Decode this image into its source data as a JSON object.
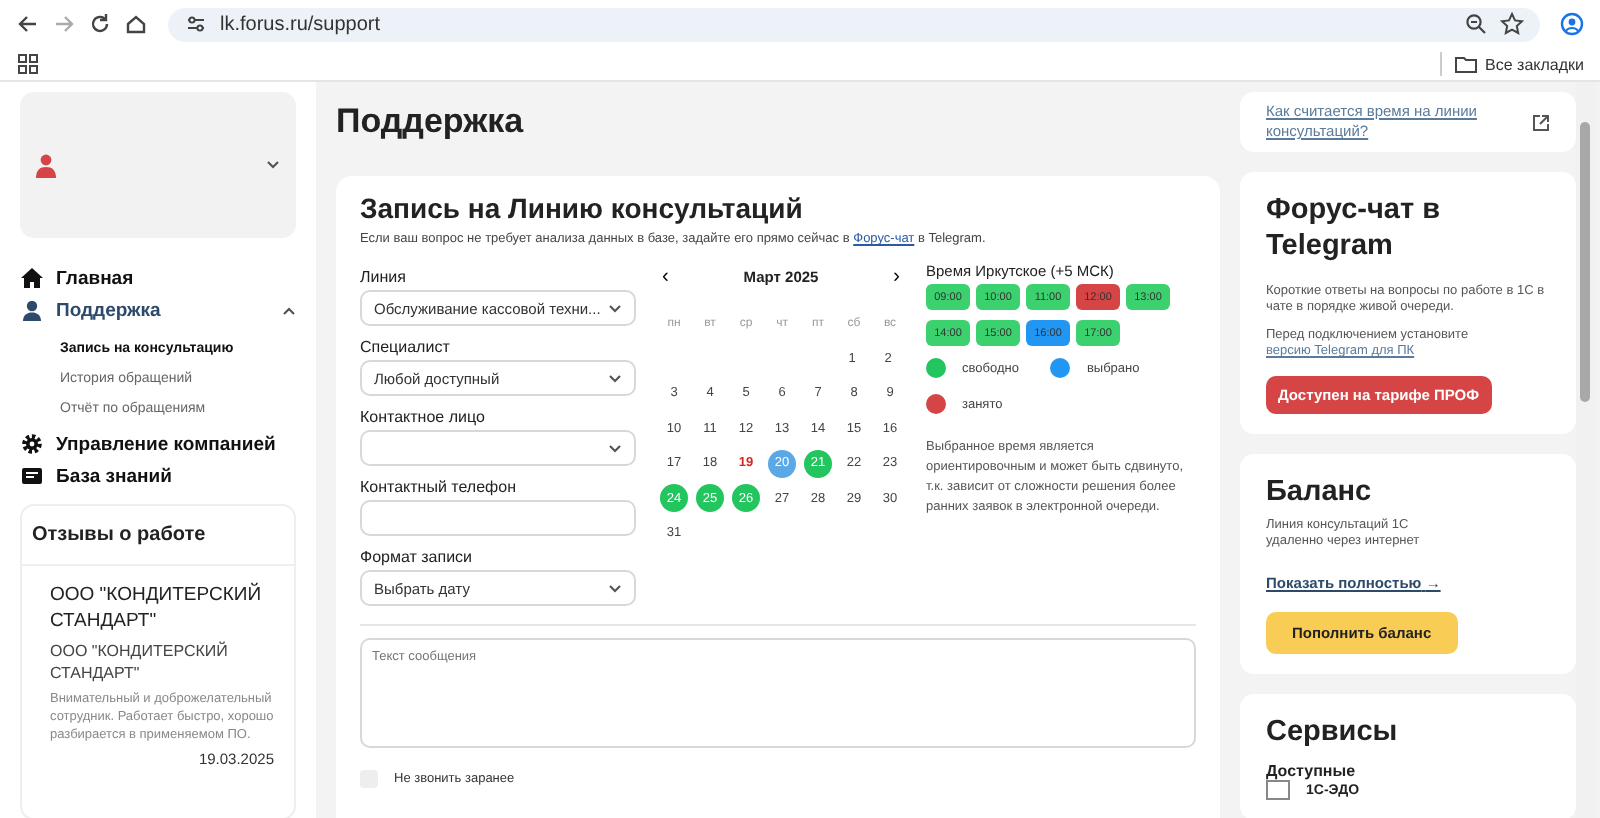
{
  "browser": {
    "url": "lk.forus.ru/support",
    "bookmarks_label": "Все закладки"
  },
  "sidebar": {
    "nav": [
      {
        "label": "Главная",
        "expanded": false
      },
      {
        "label": "Поддержка",
        "expanded": true,
        "children": [
          {
            "label": "Запись на консультацию",
            "selected": true
          },
          {
            "label": "История обращений",
            "selected": false
          },
          {
            "label": "Отчёт по обращениям",
            "selected": false
          }
        ]
      },
      {
        "label": "Управление компанией",
        "expanded": false
      },
      {
        "label": "База знаний",
        "expanded": false
      }
    ],
    "reviews": {
      "title": "Отзывы о работе",
      "company": "ООО \"КОНДИТЕРСКИЙ СТАНДАРТ\"",
      "subtitle": "ООО \"КОНДИТЕРСКИЙ СТАНДАРТ\"",
      "text": "Внимательный и доброжелательный сотрудник. Работает быстро, хорошо разбирается в применяемом ПО.",
      "date": "19.03.2025"
    }
  },
  "page_title": "Поддержка",
  "form": {
    "title": "Запись на Линию консультаций",
    "intro_before": "Если ваш вопрос не требует анализа данных в базе, задайте его прямо сейчас в",
    "intro_link": "Форус-чат",
    "intro_after": "в Telegram.",
    "fields": [
      {
        "label": "Линия",
        "kind": "select",
        "value": "Обслуживание кассовой техни..."
      },
      {
        "label": "Специалист",
        "kind": "select",
        "value": "Любой доступный"
      },
      {
        "label": "Контактное лицо",
        "kind": "select"
      },
      {
        "label": "Контактный телефон",
        "kind": "input"
      },
      {
        "label": "Формат записи",
        "kind": "select",
        "value": "Выбрать дату"
      }
    ],
    "calendar": {
      "month": "Март 2025",
      "prev": "‹",
      "next": "›",
      "weekdays": [
        "пн",
        "вт",
        "ср",
        "чт",
        "пт",
        "сб",
        "вс"
      ],
      "weeks": [
        [
          {
            "label": "1",
            "kind": "normal"
          },
          {
            "label": "2",
            "kind": "normal"
          }
        ],
        [
          {
            "label": "3",
            "kind": "normal"
          },
          {
            "label": "4",
            "kind": "normal"
          },
          {
            "label": "5",
            "kind": "normal"
          },
          {
            "label": "6",
            "kind": "normal"
          },
          {
            "label": "7",
            "kind": "normal"
          },
          {
            "label": "8",
            "kind": "normal"
          },
          {
            "label": "9",
            "kind": "normal"
          }
        ],
        [
          {
            "label": "10",
            "kind": "normal"
          },
          {
            "label": "11",
            "kind": "normal"
          },
          {
            "label": "12",
            "kind": "normal"
          },
          {
            "label": "13",
            "kind": "normal"
          },
          {
            "label": "14",
            "kind": "normal"
          },
          {
            "label": "15",
            "kind": "normal"
          },
          {
            "label": "16",
            "kind": "normal"
          }
        ],
        [
          {
            "label": "17",
            "kind": "normal"
          },
          {
            "label": "18",
            "kind": "normal"
          },
          {
            "label": "19",
            "kind": "today"
          },
          {
            "label": "20",
            "kind": "selected"
          },
          {
            "label": "21",
            "kind": "available"
          },
          {
            "label": "22",
            "kind": "normal"
          },
          {
            "label": "23",
            "kind": "normal"
          }
        ],
        [
          {
            "label": "24",
            "kind": "available"
          },
          {
            "label": "25",
            "kind": "available"
          },
          {
            "label": "26",
            "kind": "available"
          },
          {
            "label": "27",
            "kind": "normal"
          },
          {
            "label": "28",
            "kind": "normal"
          },
          {
            "label": "29",
            "kind": "normal"
          },
          {
            "label": "30",
            "kind": "normal"
          }
        ],
        [
          {
            "label": "31",
            "kind": "normal"
          }
        ]
      ]
    },
    "times": {
      "title": "Время Иркутское (+5 МСК)",
      "slots": [
        {
          "label": "09:00",
          "kind": "free"
        },
        {
          "label": "10:00",
          "kind": "free"
        },
        {
          "label": "11:00",
          "kind": "free"
        },
        {
          "label": "12:00",
          "kind": "busy"
        },
        {
          "label": "13:00",
          "kind": "free"
        },
        {
          "label": "14:00",
          "kind": "free"
        },
        {
          "label": "15:00",
          "kind": "free"
        },
        {
          "label": "16:00",
          "kind": "selected"
        },
        {
          "label": "17:00",
          "kind": "free"
        }
      ],
      "legend": [
        {
          "label": "свободно",
          "color": "#22c55e"
        },
        {
          "label": "выбрано",
          "color": "#2196f3"
        },
        {
          "label": "занято",
          "color": "#d64545"
        }
      ],
      "note": "Выбранное время является ориентировочным и может быть сдвинуто, т.к. зависит от сложности решения более ранних заявок в электронной очереди."
    },
    "message": {
      "placeholder": "Текст сообщения"
    },
    "no_call": {
      "label": "Не звонить заранее",
      "checked": false
    }
  },
  "right": {
    "help_link": "Как считается время на линии консультаций?",
    "telegram": {
      "title": "Форус-чат в Telegram",
      "text": "Короткие ответы на вопросы по работе в 1С в чате в порядке живой очереди.",
      "install_before": "Перед подключением установите",
      "install_link": "версию Telegram для ПК",
      "button": "Доступен на тарифе ПРОФ"
    },
    "balance": {
      "title": "Баланс",
      "text": "Линия консультаций 1С удаленно через интернет",
      "link": "Показать полностью",
      "link_arrow": "→",
      "button": "Пополнить баланс"
    },
    "services": {
      "title": "Сервисы",
      "section": "Доступные",
      "items": [
        "1С-ЭДО"
      ]
    }
  }
}
